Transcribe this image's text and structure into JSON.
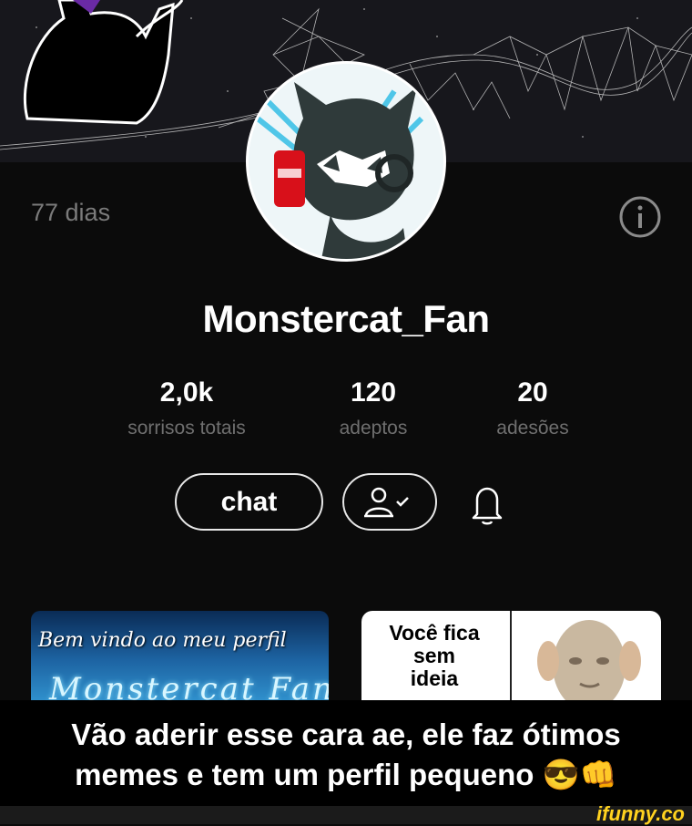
{
  "profile": {
    "days": "77 dias",
    "username": "Monstercat_Fan",
    "stats": [
      {
        "value": "2,0k",
        "label": "sorrisos totais"
      },
      {
        "value": "120",
        "label": "adeptos"
      },
      {
        "value": "20",
        "label": "adesões"
      }
    ],
    "chat_label": "chat"
  },
  "posts": {
    "post1_line1": "Bem vindo ao meu perfil",
    "post1_line2": "Monstercat Fan",
    "post2_lines": [
      "Você fica",
      "sem",
      "ideia"
    ]
  },
  "caption": {
    "line1": "Vão aderir esse cara ae, ele faz ótimos",
    "line2": "memes e tem um perfil pequeno 😎👊"
  },
  "watermark": "ifunny.co",
  "colors": {
    "background": "#0b0b0b",
    "muted_text": "#7b7b7b",
    "watermark": "#ffd21f"
  }
}
